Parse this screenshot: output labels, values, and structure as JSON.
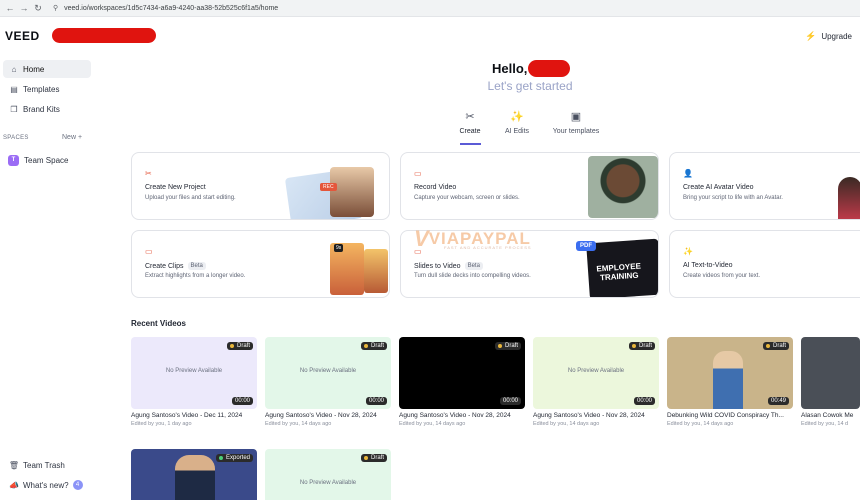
{
  "browser": {
    "url": "veed.io/workspaces/1d5c7434-a6a9-4240-aa38-52b525c6f1a5/home",
    "back_icon": "arrow-left-icon",
    "forward_icon": "arrow-right-icon",
    "reload_icon": "reload-icon"
  },
  "header": {
    "logo": "VEED",
    "upgrade_label": "Upgrade"
  },
  "sidebar": {
    "items": [
      {
        "label": "Home",
        "icon": "home-icon",
        "active": true
      },
      {
        "label": "Templates",
        "icon": "templates-icon"
      },
      {
        "label": "Brand Kits",
        "icon": "brand-kits-icon"
      }
    ],
    "spaces_label": "SPACES",
    "new_label": "New +",
    "team_space": {
      "badge": "T",
      "label": "Team Space"
    },
    "bottom": [
      {
        "label": "Team Trash",
        "icon": "trash-icon"
      },
      {
        "label": "What's new?",
        "icon": "megaphone-icon",
        "count": "4"
      }
    ]
  },
  "hero": {
    "greeting": "Hello,",
    "subtitle": "Let's get started"
  },
  "tabs": [
    {
      "label": "Create",
      "icon": "scissors-icon",
      "active": true
    },
    {
      "label": "AI Edits",
      "icon": "magic-wand-icon"
    },
    {
      "label": "Your templates",
      "icon": "templates-icon"
    }
  ],
  "cards": [
    {
      "title": "Create New Project",
      "desc": "Upload your files and start editing.",
      "icon": "scissors-icon",
      "thumb_badge": "REC"
    },
    {
      "title": "Record Video",
      "desc": "Capture your webcam, screen or slides.",
      "icon": "record-icon"
    },
    {
      "title": "Create AI Avatar Video",
      "desc": "Bring your script to life with an Avatar.",
      "icon": "avatar-icon"
    },
    {
      "title": "Create Clips",
      "beta": "Beta",
      "desc": "Extract highlights from a longer video.",
      "icon": "clips-icon",
      "thumb_badge": "9s"
    },
    {
      "title": "Slides to Video",
      "beta": "Beta",
      "desc": "Turn dull slide decks into compelling videos.",
      "icon": "slides-icon",
      "pdf_label": "PDF",
      "slide_title": "EMPLOYEE TRAINING"
    },
    {
      "title": "AI Text-to-Video",
      "desc": "Create videos from your text.",
      "icon": "magic-wand-icon"
    }
  ],
  "watermark": {
    "mark": "V",
    "text": "VIAPAYPAL",
    "tagline": "FAST AND ACCURATE PROCESS"
  },
  "recent": {
    "title": "Recent Videos",
    "videos": [
      {
        "title": "Agung Santoso's Video - Dec 11, 2024",
        "meta": "Edited by you, 1 day ago",
        "status": "Draft",
        "duration": "00:00",
        "preview": "No Preview Available",
        "bg": "#ece9fb"
      },
      {
        "title": "Agung Santoso's Video - Nov 28, 2024",
        "meta": "Edited by you, 14 days ago",
        "status": "Draft",
        "duration": "00:00",
        "preview": "No Preview Available",
        "bg": "#e3f7e9"
      },
      {
        "title": "Agung Santoso's Video - Nov 28, 2024",
        "meta": "Edited by you, 14 days ago",
        "status": "Draft",
        "duration": "00:00",
        "preview": "",
        "bg": "#000000"
      },
      {
        "title": "Agung Santoso's Video - Nov 28, 2024",
        "meta": "Edited by you, 14 days ago",
        "status": "Draft",
        "duration": "00:00",
        "preview": "No Preview Available",
        "bg": "#ecf7dc"
      },
      {
        "title": "Debunking Wild COVID Conspiracy Th...",
        "meta": "Edited by you, 14 days ago",
        "status": "Draft",
        "duration": "00:49",
        "preview": "",
        "bg": "#c9b48a"
      },
      {
        "title": "Alasan Cowok Me",
        "meta": "Edited by you, 14 d",
        "status": "",
        "duration": "",
        "preview": "",
        "bg": "#4a4f57"
      },
      {
        "title": "",
        "meta": "",
        "status": "Exported",
        "duration": "",
        "preview": "",
        "bg": "#3a4a8a"
      },
      {
        "title": "",
        "meta": "",
        "status": "Draft",
        "duration": "",
        "preview": "No Preview Available",
        "bg": "#e3f7e9"
      }
    ]
  },
  "colors": {
    "accent": "#5b5bd6",
    "team_badge": "#9b6cf5",
    "redaction": "#e0140f"
  }
}
